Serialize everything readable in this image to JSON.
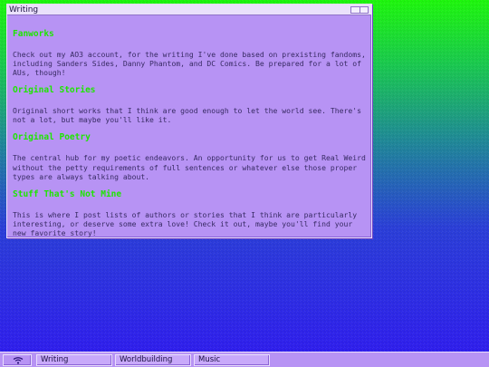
{
  "window": {
    "title": "Writing"
  },
  "sections": [
    {
      "title": "Fanworks",
      "body": "Check out my AO3 account, for the writing I've done based on prexisting fandoms, including Sanders Sides, Danny Phantom, and DC Comics. Be prepared for a lot of AUs, though!"
    },
    {
      "title": "Original Stories",
      "body": "Original short works that I think are good enough to let the world see. There's not a lot, but maybe you'll like it."
    },
    {
      "title": "Original Poetry",
      "body": "The central hub for my poetic endeavors. An opportunity for us to get Real Weird without the petty requirements of full sentences or whatever else those proper types are always talking about."
    },
    {
      "title": "Stuff That's Not Mine",
      "body": "This is where I post lists of authors or stories that I think are particularly interesting, or deserve some extra love! Check it out, maybe you'll find your new favorite story!"
    }
  ],
  "taskbar": {
    "items": [
      "Writing",
      "Worldbuilding",
      "Music"
    ],
    "start_icon": "wifi-icon"
  },
  "colors": {
    "accent_green": "#1ee600",
    "window_bg": "#b793f4",
    "text": "#372a63"
  }
}
